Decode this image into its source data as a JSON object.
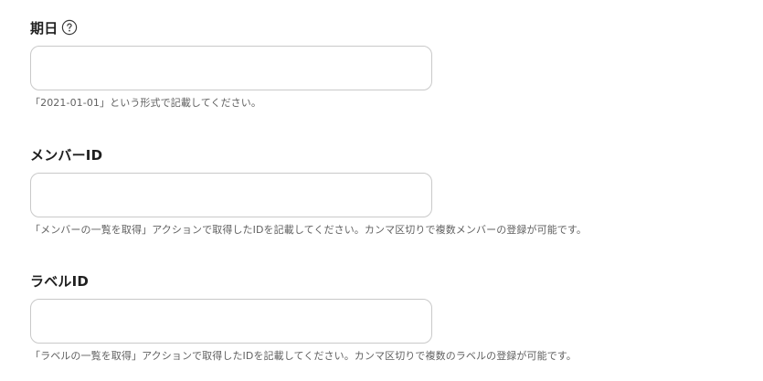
{
  "fields": [
    {
      "label": "期日",
      "has_help": true,
      "value": "",
      "placeholder": "",
      "hint": "「2021-01-01」という形式で記載してください。"
    },
    {
      "label": "メンバーID",
      "has_help": false,
      "value": "",
      "placeholder": "",
      "hint": "「メンバーの一覧を取得」アクションで取得したIDを記載してください。カンマ区切りで複数メンバーの登録が可能です。"
    },
    {
      "label": "ラベルID",
      "has_help": false,
      "value": "",
      "placeholder": "",
      "hint": "「ラベルの一覧を取得」アクションで取得したIDを記載してください。カンマ区切りで複数のラベルの登録が可能です。"
    }
  ],
  "icons": {
    "help": "question-circle-icon"
  },
  "colors": {
    "border": "#c9c9c9",
    "hint_text": "#616161",
    "label_text": "#1f1f1f"
  }
}
